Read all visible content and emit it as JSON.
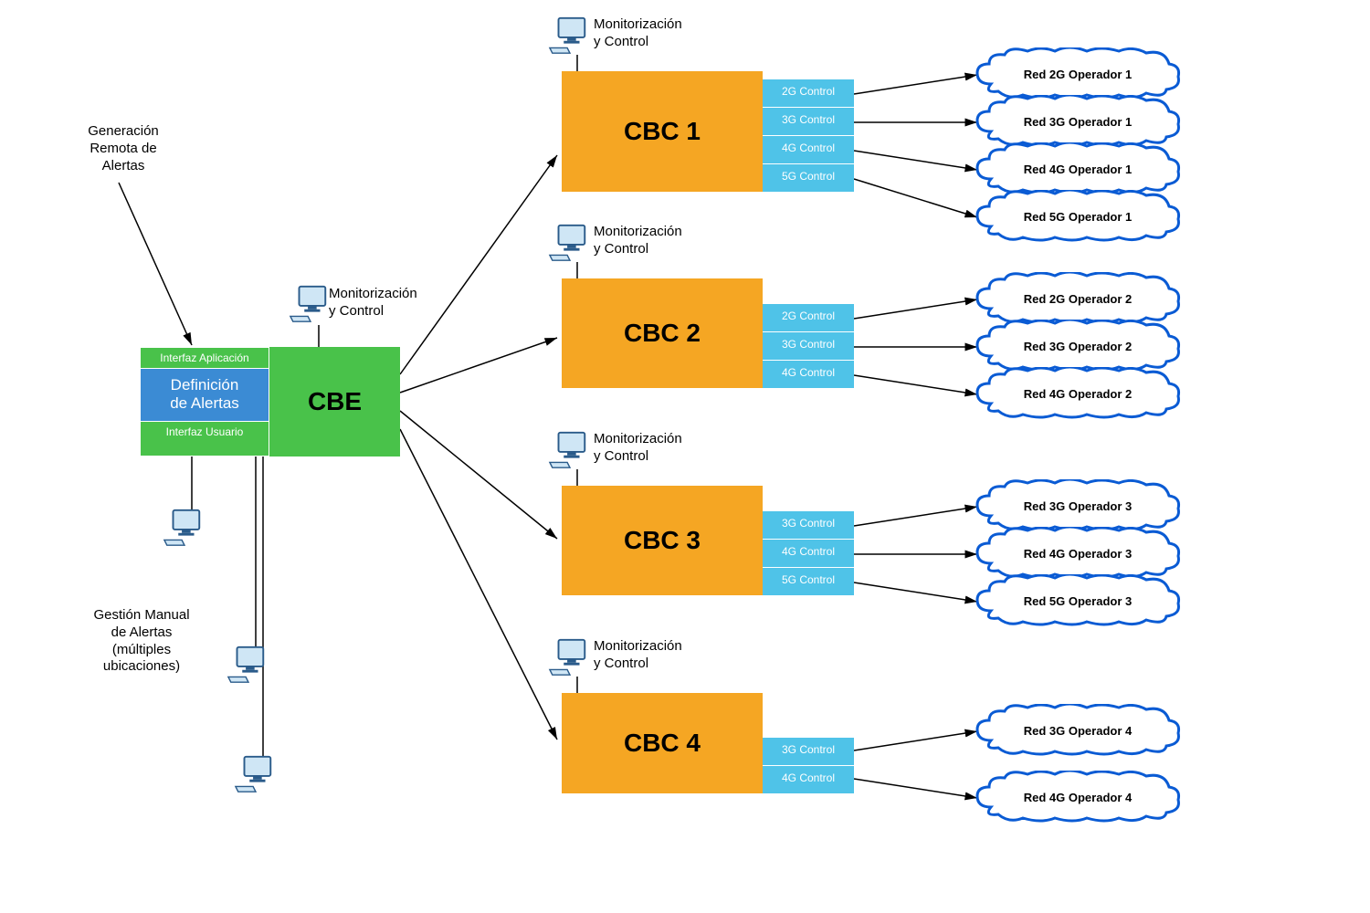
{
  "labels": {
    "gen_remota": "Generación\nRemota de\nAlertas",
    "mon_control": "Monitorización\ny Control",
    "gestion_manual": "Gestión Manual\nde Alertas\n(múltiples\nubicaciones)"
  },
  "cbe": {
    "title": "CBE",
    "strip_top": "Interfaz Aplicación",
    "def": "Definición\nde Alertas",
    "strip_bottom": "Interfaz Usuario"
  },
  "cbc": [
    {
      "title": "CBC 1",
      "controls": [
        "2G Control",
        "3G Control",
        "4G Control",
        "5G Control"
      ],
      "networks": [
        "Red 2G Operador 1",
        "Red 3G Operador 1",
        "Red 4G Operador 1",
        "Red 5G Operador 1"
      ]
    },
    {
      "title": "CBC 2",
      "controls": [
        "2G Control",
        "3G Control",
        "4G Control"
      ],
      "networks": [
        "Red 2G Operador 2",
        "Red 3G Operador 2",
        "Red 4G Operador 2"
      ]
    },
    {
      "title": "CBC 3",
      "controls": [
        "3G Control",
        "4G Control",
        "5G Control"
      ],
      "networks": [
        "Red 3G Operador 3",
        "Red 4G Operador 3",
        "Red 5G Operador 3"
      ]
    },
    {
      "title": "CBC 4",
      "controls": [
        "3G Control",
        "4G Control"
      ],
      "networks": [
        "Red 3G Operador 4",
        "Red 4G Operador 4"
      ]
    }
  ]
}
